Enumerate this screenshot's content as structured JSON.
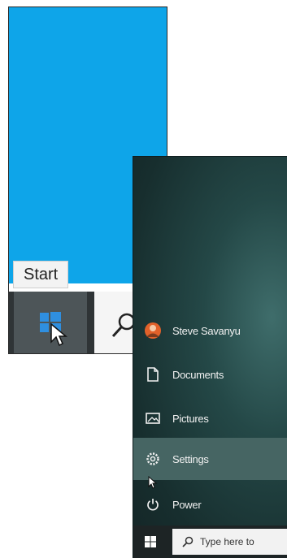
{
  "desktop": {
    "start_tooltip": "Start",
    "search_placeholder": ""
  },
  "start_menu": {
    "items": [
      {
        "label": "Steve Savanyu",
        "icon": "user-avatar-icon"
      },
      {
        "label": "Documents",
        "icon": "document-icon"
      },
      {
        "label": "Pictures",
        "icon": "pictures-icon"
      },
      {
        "label": "Settings",
        "icon": "gear-icon",
        "active": true
      },
      {
        "label": "Power",
        "icon": "power-icon"
      }
    ],
    "search_placeholder": "Type here to"
  },
  "colors": {
    "desktop_blue": "#0ea5e9",
    "taskbar": "#2f3436",
    "start_menu_bg": "#172e2e",
    "active_item": "#466563",
    "windows_logo": "#2f8fe0",
    "avatar": "#e0612a"
  }
}
